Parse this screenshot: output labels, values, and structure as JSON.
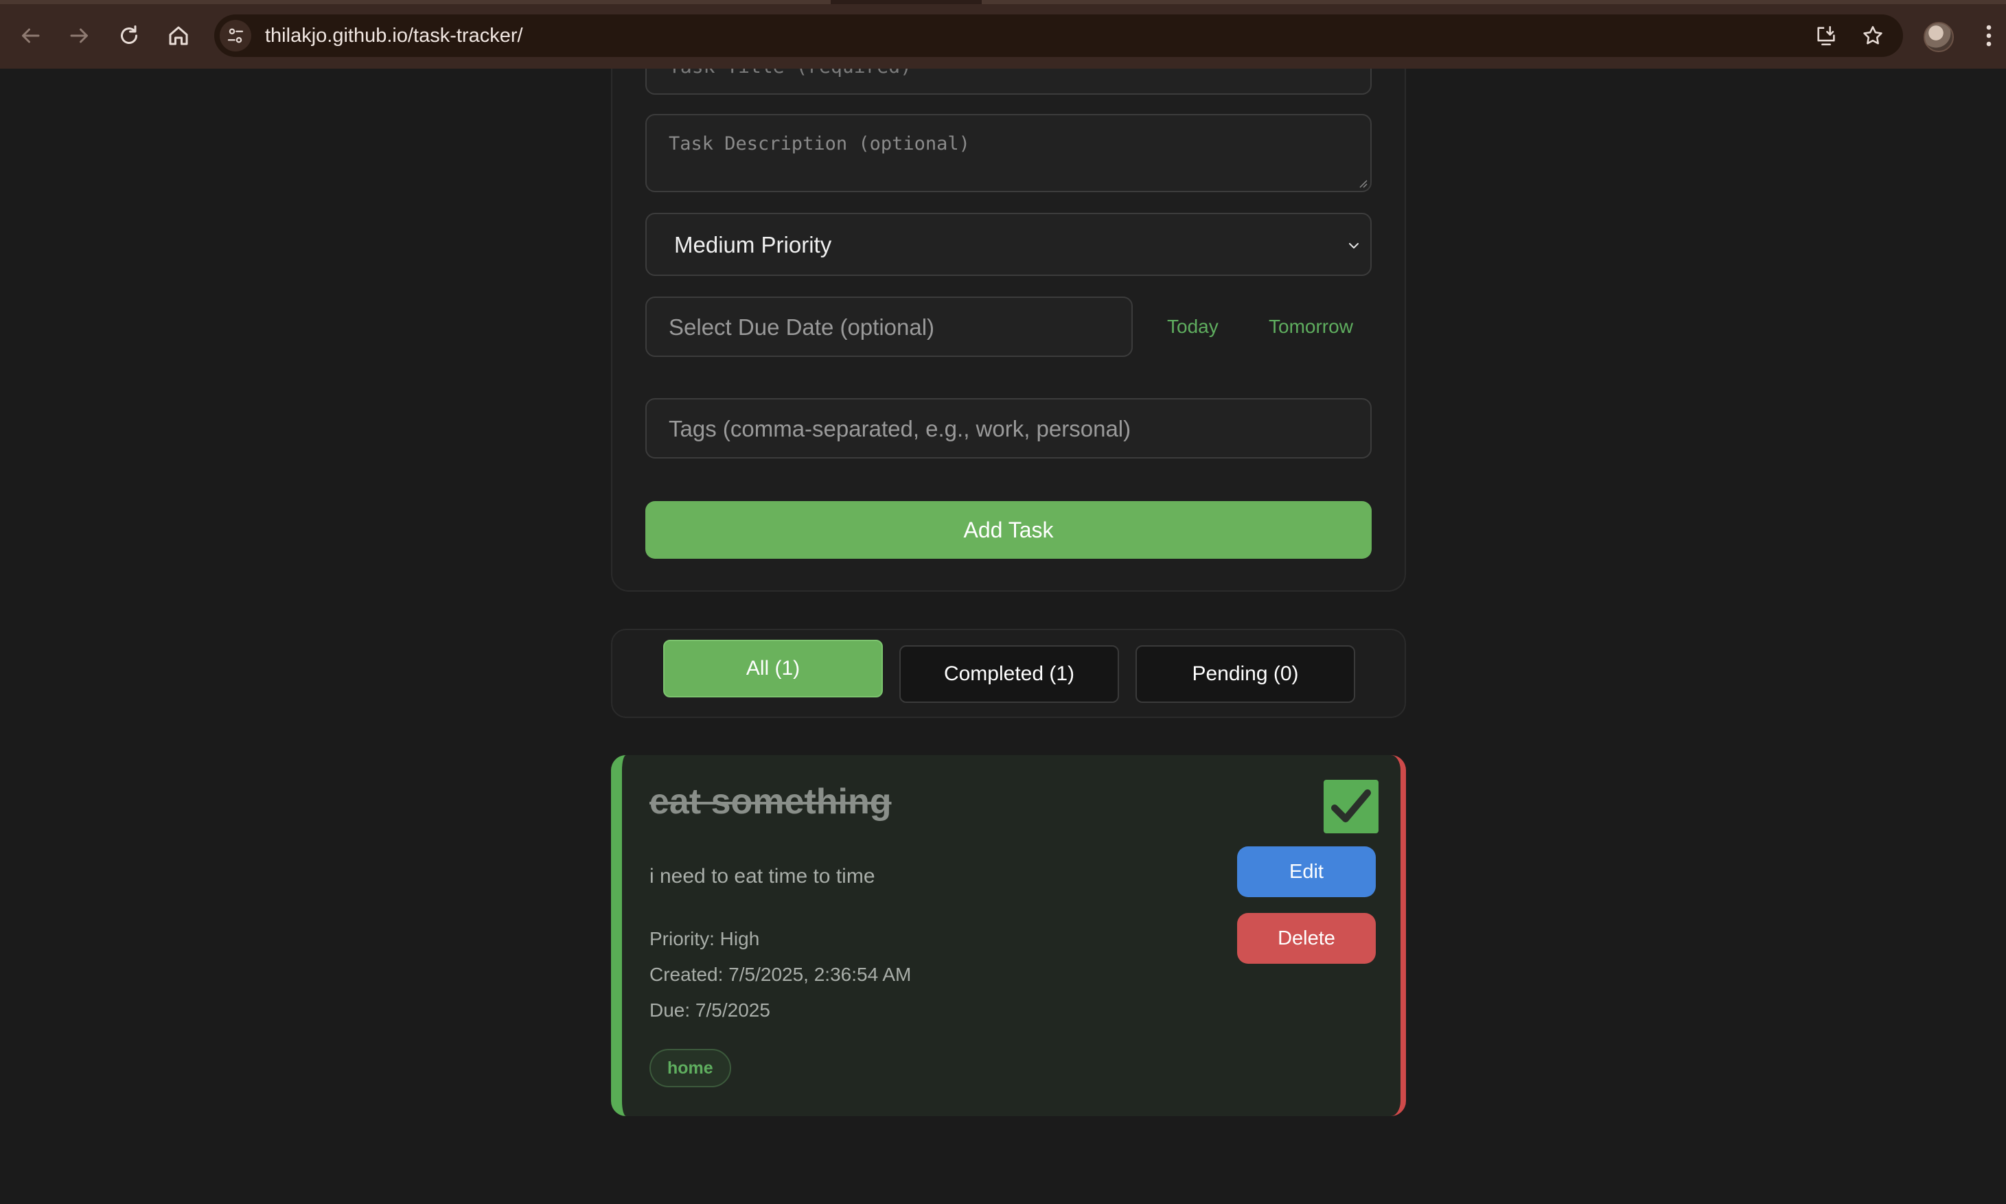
{
  "browser": {
    "url": "thilakjo.github.io/task-tracker/"
  },
  "form": {
    "title_placeholder": "Task Title (required)",
    "description_placeholder": "Task Description (optional)",
    "priority_selected": "Medium Priority",
    "due_date_placeholder": "Select Due Date (optional)",
    "today_label": "Today",
    "tomorrow_label": "Tomorrow",
    "tags_placeholder": "Tags (comma-separated, e.g., work, personal)",
    "add_button": "Add Task"
  },
  "filters": [
    {
      "label": "All (1)",
      "active": true
    },
    {
      "label": "Completed (1)",
      "active": false
    },
    {
      "label": "Pending (0)",
      "active": false
    }
  ],
  "task": {
    "title": "eat something",
    "description": "i need to eat time to time",
    "priority": "Priority: High",
    "created": "Created: 7/5/2025, 2:36:54 AM",
    "due": "Due: 7/5/2025",
    "tag": "home",
    "completed": true,
    "edit_label": "Edit",
    "delete_label": "Delete"
  },
  "colors": {
    "accent_green": "#6ab25c",
    "edit_blue": "#4384dc",
    "delete_red": "#cf5252",
    "page_bg": "#1b1b1b"
  },
  "icons": [
    "back-arrow-icon",
    "forward-arrow-icon",
    "reload-icon",
    "home-icon",
    "site-settings-icon",
    "install-app-icon",
    "bookmark-star-icon",
    "profile-avatar",
    "more-vert-icon",
    "chevron-down-icon",
    "checkmark-icon"
  ]
}
